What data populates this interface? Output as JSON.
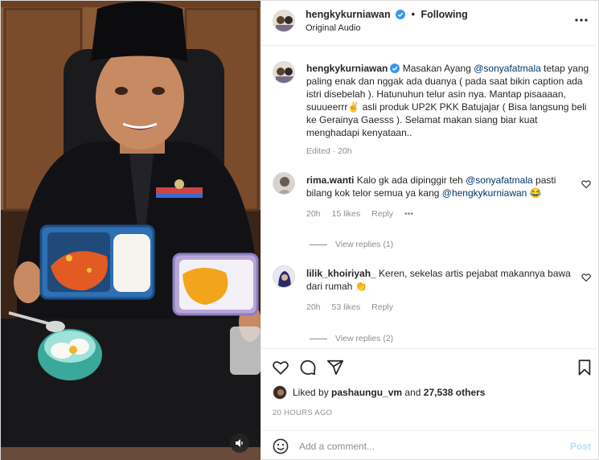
{
  "header": {
    "username": "hengkykurniawan",
    "separator": "•",
    "follow_label": "Following",
    "audio_label": "Original Audio"
  },
  "caption": {
    "username": "hengkykurniawan",
    "text_1": "Masakan Ayang ",
    "mention_1": "@sonyafatmala",
    "text_2": " tetap yang paling enak dan nggak ada duanya ( pada saat bikin caption ada istri disebelah ). Hatunuhun telur asin nya. Mantap pisaaaan, suuueerrr✌️ asli produk UP2K PKK Batujajar ( Bisa langsung beli ke Gerainya Gaesss ). Selamat makan siang biar kuat menghadapi kenyataan..",
    "meta": "Edited · 20h"
  },
  "comments": [
    {
      "username": "rima.wanti",
      "text_1": " Kalo gk ada dipinggir teh ",
      "mention_1": "@sonyafatmala",
      "text_2": " pasti bilang kok telor semua ya kang ",
      "mention_2": "@hengkykurniawan",
      "text_3": " 😂",
      "time": "20h",
      "likes": "15 likes",
      "reply": "Reply",
      "more": "•••",
      "view_replies": "View replies (1)"
    },
    {
      "username": "lilik_khoiriyah_",
      "text_1": " Keren, sekelas artis pejabat makannya bawa dari rumah 👏",
      "time": "20h",
      "likes": "53 likes",
      "reply": "Reply",
      "view_replies": "View replies (2)"
    }
  ],
  "likes": {
    "prefix": "Liked by ",
    "user": "pashaungu_vm",
    "middle": " and ",
    "count": "27,538 others"
  },
  "timestamp": "20 HOURS AGO",
  "add_comment": {
    "placeholder": "Add a comment...",
    "post_label": "Post"
  },
  "icons": {
    "verified": "verified-badge-icon",
    "more": "more-options-icon",
    "like": "heart-icon",
    "comment": "comment-icon",
    "share": "share-icon",
    "save": "bookmark-icon",
    "emoji": "emoji-icon",
    "audio": "speaker-icon"
  },
  "colors": {
    "link": "#00376b",
    "verified": "#3897f0",
    "post_disabled": "#b2dffc",
    "secondary_text": "#8e8e8e"
  }
}
